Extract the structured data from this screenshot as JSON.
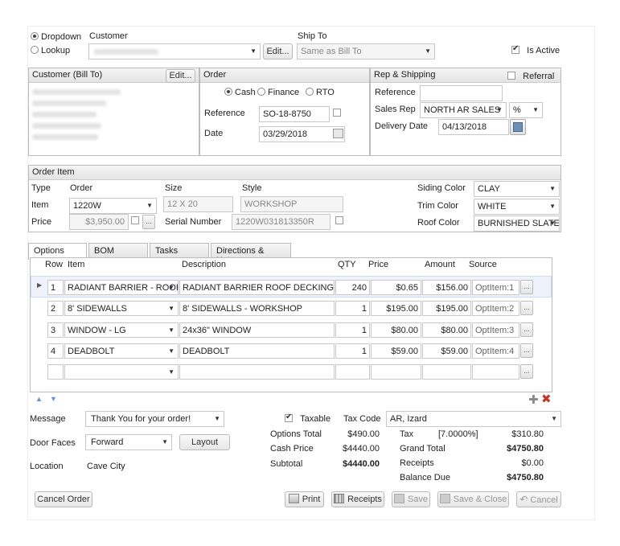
{
  "top": {
    "mode_dropdown": "Dropdown",
    "mode_lookup": "Lookup",
    "customer_label": "Customer",
    "ship_to_label": "Ship To",
    "edit_label": "Edit...",
    "ship_to_value": "Same as Bill To",
    "is_active_label": "Is Active"
  },
  "bill_to": {
    "title": "Customer (Bill To)",
    "edit_label": "Edit..."
  },
  "order": {
    "title": "Order",
    "pay_cash": "Cash",
    "pay_finance": "Finance",
    "pay_rto": "RTO",
    "reference_label": "Reference",
    "reference_value": "SO-18-8750",
    "date_label": "Date",
    "date_value": "03/29/2018"
  },
  "rep": {
    "title": "Rep & Shipping",
    "referral_label": "Referral",
    "reference_label": "Reference",
    "sales_rep_label": "Sales Rep",
    "sales_rep_value": "NORTH AR SALES",
    "percent_value": "%",
    "delivery_label": "Delivery Date",
    "delivery_value": "04/13/2018"
  },
  "order_item": {
    "title": "Order Item",
    "type_label": "Type",
    "order_label": "Order",
    "size_label": "Size",
    "style_label": "Style",
    "item_label": "Item",
    "item_value": "1220W",
    "size_value": "12 X 20",
    "style_value": "WORKSHOP",
    "price_label": "Price",
    "price_value": "$3,950.00",
    "serial_label": "Serial Number",
    "serial_value": "1220W031813350R",
    "siding_label": "Siding Color",
    "siding_value": "CLAY",
    "trim_label": "Trim Color",
    "trim_value": "WHITE",
    "roof_label": "Roof Color",
    "roof_value": "BURNISHED SLATE"
  },
  "tabs": [
    "Options",
    "BOM",
    "Tasks",
    "Directions & Notes"
  ],
  "grid": {
    "headers": {
      "row": "Row",
      "item": "Item",
      "description": "Description",
      "qty": "QTY",
      "price": "Price",
      "amount": "Amount",
      "source": "Source"
    },
    "rows": [
      {
        "row": "1",
        "item": "RADIANT BARRIER - ROOF DECKING",
        "description": "RADIANT BARRIER ROOF DECKING",
        "qty": "240",
        "price": "$0.65",
        "amount": "$156.00",
        "source": "OptItem:1"
      },
      {
        "row": "2",
        "item": "8' SIDEWALLS",
        "description": "8' SIDEWALLS - WORKSHOP",
        "qty": "1",
        "price": "$195.00",
        "amount": "$195.00",
        "source": "OptItem:2"
      },
      {
        "row": "3",
        "item": "WINDOW - LG",
        "description": "24x36\" WINDOW",
        "qty": "1",
        "price": "$80.00",
        "amount": "$80.00",
        "source": "OptItem:3"
      },
      {
        "row": "4",
        "item": "DEADBOLT",
        "description": "DEADBOLT",
        "qty": "1",
        "price": "$59.00",
        "amount": "$59.00",
        "source": "OptItem:4"
      }
    ]
  },
  "footer": {
    "message_label": "Message",
    "message_value": "Thank You for your order!",
    "door_faces_label": "Door Faces",
    "door_faces_value": "Forward",
    "layout_label": "Layout",
    "location_label": "Location",
    "location_value": "Cave City",
    "taxable_label": "Taxable",
    "tax_code_label": "Tax Code",
    "tax_code_value": "AR, Izard",
    "options_total_label": "Options Total",
    "options_total_value": "$490.00",
    "cash_price_label": "Cash Price",
    "cash_price_value": "$4440.00",
    "subtotal_label": "Subtotal",
    "subtotal_value": "$4440.00",
    "tax_label": "Tax",
    "tax_rate": "[7.0000%]",
    "tax_value": "$310.80",
    "grand_total_label": "Grand Total",
    "grand_total_value": "$4750.80",
    "receipts_label": "Receipts",
    "receipts_value": "$0.00",
    "balance_due_label": "Balance Due",
    "balance_due_value": "$4750.80"
  },
  "buttons": {
    "cancel_order": "Cancel Order",
    "print": "Print",
    "receipts": "Receipts",
    "save": "Save",
    "save_close": "Save & Close",
    "cancel": "Cancel"
  }
}
